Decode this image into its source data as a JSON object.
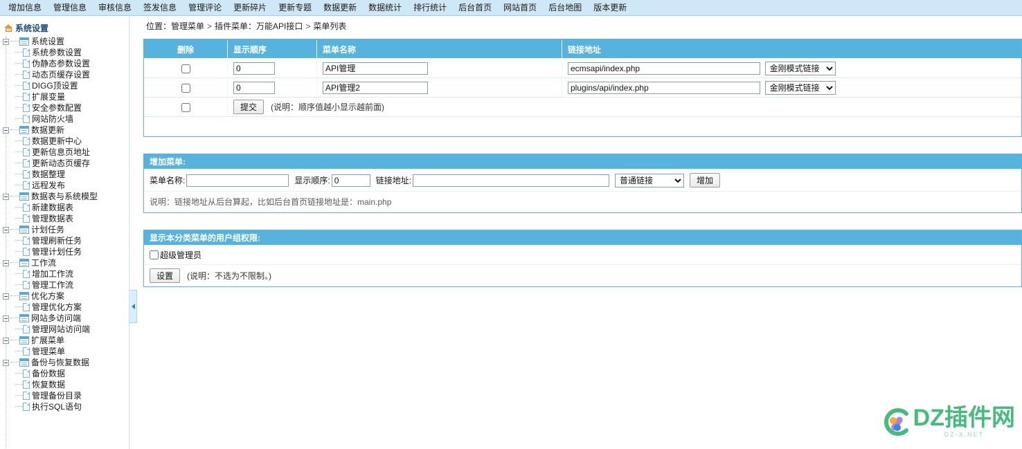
{
  "topnav": {
    "items": [
      "增加信息",
      "管理信息",
      "审核信息",
      "签发信息",
      "管理评论",
      "更新碎片",
      "更新专题",
      "数据更新",
      "数据统计",
      "排行统计",
      "后台首页",
      "网站首页",
      "后台地图",
      "版本更新"
    ]
  },
  "sidebar": {
    "title": "系统设置",
    "groups": [
      {
        "label": "系统设置",
        "children": [
          "系统参数设置",
          "伪静态参数设置",
          "动态页缓存设置",
          "DIGG顶设置",
          "扩展变量",
          "安全参数配置",
          "网站防火墙"
        ]
      },
      {
        "label": "数据更新",
        "children": [
          "数据更新中心",
          "更新信息页地址",
          "更新动态页缓存",
          "数据整理",
          "远程发布"
        ]
      },
      {
        "label": "数据表与系统模型",
        "children": [
          "新建数据表",
          "管理数据表"
        ]
      },
      {
        "label": "计划任务",
        "children": [
          "管理刷新任务",
          "管理计划任务"
        ]
      },
      {
        "label": "工作流",
        "children": [
          "增加工作流",
          "管理工作流"
        ]
      },
      {
        "label": "优化方案",
        "children": [
          "管理优化方案"
        ]
      },
      {
        "label": "网站多访问端",
        "children": [
          "管理网站访问端"
        ]
      },
      {
        "label": "扩展菜单",
        "children": [
          "管理菜单"
        ]
      },
      {
        "label": "备份与恢复数据",
        "children": [
          "备份数据",
          "恢复数据",
          "管理备份目录",
          "执行SQL语句"
        ]
      }
    ]
  },
  "breadcrumb": {
    "prefix": "位置：",
    "parts": [
      "管理菜单",
      "插件菜单：万能API接口",
      "菜单列表"
    ],
    "separator": ">"
  },
  "menu_table": {
    "headers": [
      "删除",
      "显示顺序",
      "菜单名称",
      "链接地址"
    ],
    "rows": [
      {
        "checked": false,
        "order": "0",
        "name": "API管理",
        "link": "ecmsapi/index.php",
        "type": "金刚模式链接"
      },
      {
        "checked": false,
        "order": "0",
        "name": "API管理2",
        "link": "plugins/api/index.php",
        "type": "金刚模式链接"
      }
    ],
    "link_type_options": [
      "金刚模式链接",
      "普通链接"
    ],
    "submit_label": "提交",
    "submit_hint": "(说明：顺序值越小显示越前面)"
  },
  "add_menu": {
    "panel_title": "增加菜单:",
    "name_label": "菜单名称:",
    "name_value": "",
    "order_label": "显示顺序:",
    "order_value": "0",
    "link_label": "链接地址:",
    "link_value": "",
    "type_selected": "普通链接",
    "type_options": [
      "普通链接",
      "金刚模式链接"
    ],
    "add_label": "增加",
    "note": "说明：链接地址从后台算起，比如后台首页链接地址是：main.php"
  },
  "perms": {
    "panel_title": "显示本分类菜单的用户组权限:",
    "groups": [
      {
        "label": "超级管理员",
        "checked": false
      }
    ],
    "set_label": "设置",
    "note": "(说明：不选为不限制。)"
  },
  "watermark": {
    "text": "DZ插件网",
    "sub": "DZ-X.NET"
  },
  "colors": {
    "nav_bg": "#cfe8f7",
    "panel_header": "#55b3dd",
    "panel_border": "#58b4dd",
    "brand_green": "#3cb878"
  }
}
